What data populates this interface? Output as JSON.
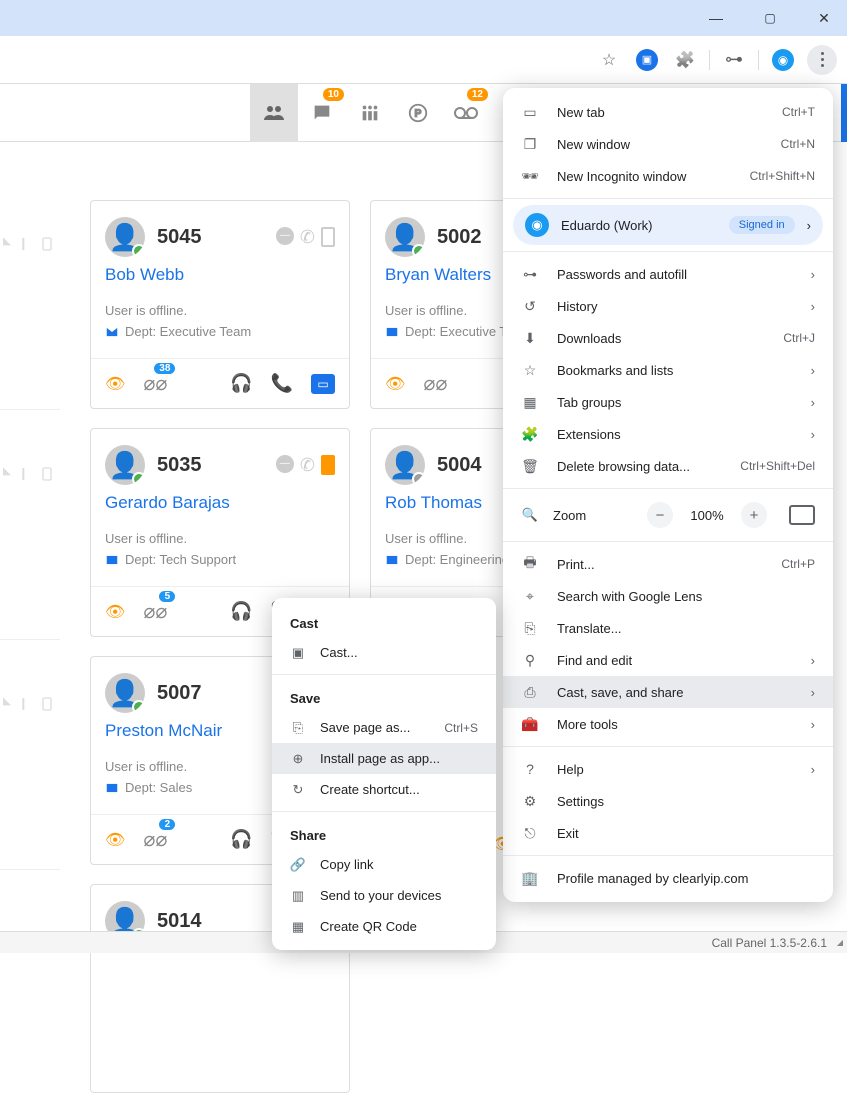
{
  "window": {
    "minimize": "—",
    "maximize": "▢",
    "close": "✕"
  },
  "tabs": {
    "chat_badge": "10",
    "vm_badge": "12"
  },
  "cards": [
    {
      "ext": "5045",
      "name": "Bob Webb",
      "status": "User is offline.",
      "dept": "Dept: Executive Team",
      "vm_badge": "38",
      "presence": "green",
      "mobile": ""
    },
    {
      "ext": "5002",
      "name": "Bryan Walters",
      "status": "User is offline.",
      "dept": "Dept: Executive Team",
      "vm_badge": "",
      "presence": "green",
      "mobile": ""
    },
    {
      "ext": "5035",
      "name": "Gerardo Barajas",
      "status": "User is offline.",
      "dept": "Dept: Tech Support",
      "vm_badge": "5",
      "presence": "green",
      "mobile": "orange"
    },
    {
      "ext": "5004",
      "name": "Rob Thomas",
      "status": "User is offline.",
      "dept": "Dept: Engineering",
      "vm_badge": "",
      "presence": "gray",
      "mobile": ""
    },
    {
      "ext": "5007",
      "name": "Preston McNair",
      "status": "User is offline.",
      "dept": "Dept: Sales",
      "vm_badge": "2",
      "presence": "green",
      "mobile": ""
    },
    {
      "ext": "5014",
      "name": "",
      "status": "",
      "dept": "",
      "vm_badge": "",
      "presence": "",
      "mobile": ""
    }
  ],
  "chrome_menu": {
    "new_tab": "New tab",
    "new_tab_sc": "Ctrl+T",
    "new_window": "New window",
    "new_window_sc": "Ctrl+N",
    "incognito": "New Incognito window",
    "incognito_sc": "Ctrl+Shift+N",
    "profile_name": "Eduardo (Work)",
    "signed_in": "Signed in",
    "passwords": "Passwords and autofill",
    "history": "History",
    "downloads": "Downloads",
    "downloads_sc": "Ctrl+J",
    "bookmarks": "Bookmarks and lists",
    "tabgroups": "Tab groups",
    "extensions": "Extensions",
    "delete_data": "Delete browsing data...",
    "delete_data_sc": "Ctrl+Shift+Del",
    "zoom": "Zoom",
    "zoom_pct": "100%",
    "print": "Print...",
    "print_sc": "Ctrl+P",
    "lens": "Search with Google Lens",
    "translate": "Translate...",
    "find": "Find and edit",
    "cast": "Cast, save, and share",
    "more_tools": "More tools",
    "help": "Help",
    "settings": "Settings",
    "exit": "Exit",
    "managed": "Profile managed by clearlyip.com"
  },
  "submenu": {
    "cast_head": "Cast",
    "cast_item": "Cast...",
    "save_head": "Save",
    "save_page": "Save page as...",
    "save_page_sc": "Ctrl+S",
    "install_app": "Install page as app...",
    "create_shortcut": "Create shortcut...",
    "share_head": "Share",
    "copy_link": "Copy link",
    "send_devices": "Send to your devices",
    "qr": "Create QR Code"
  },
  "statusbar": {
    "text": "Call Panel 1.3.5-2.6.1"
  }
}
